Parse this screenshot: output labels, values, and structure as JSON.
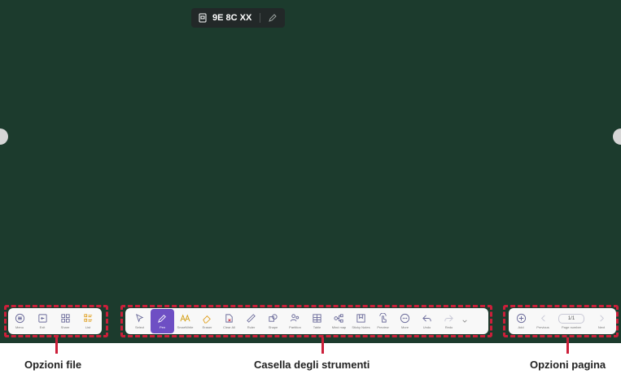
{
  "title_bar": {
    "code": "9E 8C XX"
  },
  "file_options": [
    {
      "label": "Menu",
      "icon": "menu-icon"
    },
    {
      "label": "Exit",
      "icon": "exit-icon"
    },
    {
      "label": "Share",
      "icon": "share-icon"
    },
    {
      "label": "List",
      "icon": "list-icon"
    }
  ],
  "tools": [
    {
      "label": "Select",
      "icon": "cursor-icon"
    },
    {
      "label": "Pen",
      "icon": "pen-icon",
      "active": true
    },
    {
      "label": "SmartWrite",
      "icon": "smartwrite-icon"
    },
    {
      "label": "Eraser",
      "icon": "eraser-icon"
    },
    {
      "label": "Clear All",
      "icon": "clear-all-icon"
    },
    {
      "label": "Ruler",
      "icon": "ruler-icon"
    },
    {
      "label": "Shape",
      "icon": "shape-icon"
    },
    {
      "label": "Partition",
      "icon": "partition-icon"
    },
    {
      "label": "Table",
      "icon": "table-icon"
    },
    {
      "label": "Mind map",
      "icon": "mind-map-icon"
    },
    {
      "label": "Sticky Notes",
      "icon": "sticky-notes-icon"
    },
    {
      "label": "Preview",
      "icon": "preview-icon"
    },
    {
      "label": "More",
      "icon": "more-icon"
    },
    {
      "label": "Undo",
      "icon": "undo-icon"
    },
    {
      "label": "Redo",
      "icon": "redo-icon",
      "disabled": true
    }
  ],
  "page_options": {
    "add_label": "Add",
    "previous_label": "Previous",
    "page_value": "1/1",
    "page_number_label": "Page number",
    "next_label": "Next"
  },
  "captions": {
    "file": "Opzioni file",
    "tools": "Casella degli strumenti",
    "page": "Opzioni pagina"
  },
  "colors": {
    "board": "#1c3b2d",
    "highlight": "#cc1f3a",
    "active_tool": "#6e4fc4",
    "icon": "#6b6b9a"
  }
}
